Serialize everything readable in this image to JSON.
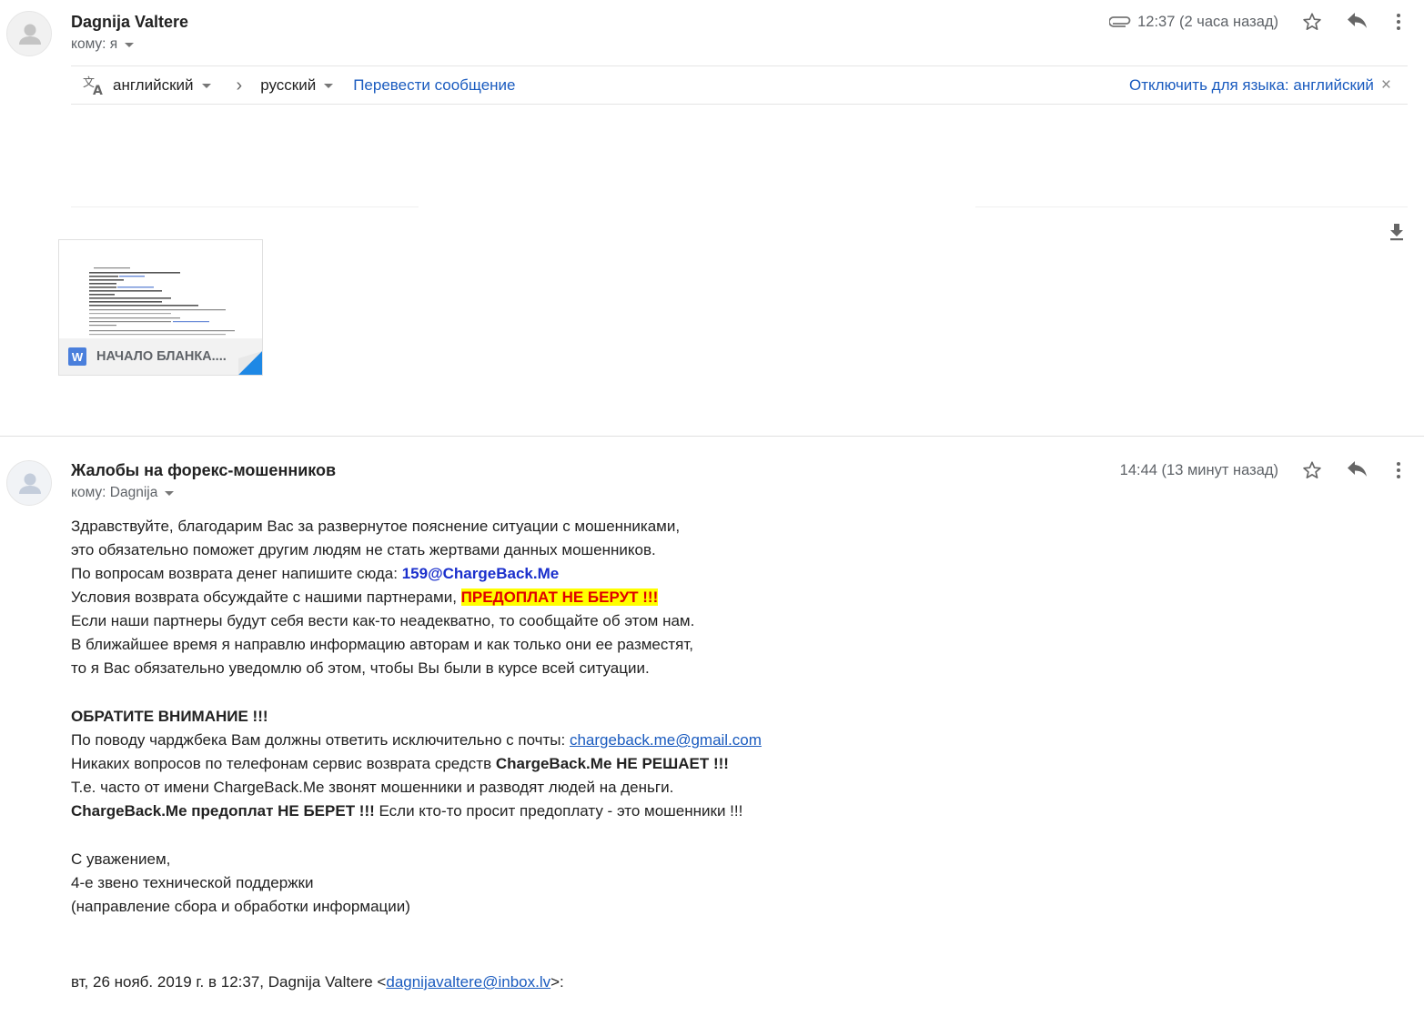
{
  "message1": {
    "sender": "Dagnija Valtere",
    "to_label": "кому: я",
    "time": "12:37 (2 часа назад)",
    "icons": [
      "paperclip-icon",
      "star-icon",
      "reply-icon",
      "more-vert-icon",
      "download-icon"
    ],
    "translate": {
      "source_lang": "английский",
      "separator": "›",
      "target_lang": "русский",
      "translate_link": "Перевести сообщение",
      "disable_link": "Отключить для языка: английский",
      "close": "×"
    },
    "attachment": {
      "name": "НАЧАЛО БЛАНКА....",
      "type_badge": "W"
    }
  },
  "message2": {
    "subject": "Жалобы на форекс-мошенников",
    "to_label": "кому: Dagnija",
    "time": "14:44 (13 минут назад)",
    "body": {
      "l1": "Здравствуйте, благодарим Вас за развернутое пояснение ситуации с мошенниками,",
      "l2": "это обязательно поможет другим людям не стать жертвами данных мошенников.",
      "l3_text": "По вопросам возврата денег напишите сюда: ",
      "l3_email": "159@ChargeBack.Me",
      "l4_text": "Условия возврата обсуждайте с нашими партнерами, ",
      "l4_warn": "ПРЕДОПЛАТ НЕ БЕРУТ !!!",
      "l5": "Если наши партнеры будут себя вести как-то неадекватно, то сообщайте об этом нам.",
      "l6": "В ближайшее время я направлю информацию авторам и как только они ее разместят,",
      "l7": "то я Вас обязательно уведомлю об этом, чтобы Вы были в курсе всей ситуации.",
      "attention": "ОБРАТИТЕ ВНИМАНИЕ !!!",
      "l8_text": "По поводу чарджбека Вам должны ответить исключительно с почты: ",
      "l8_email": "chargeback.me@gmail.com",
      "l9_text": "Никаких вопросов по телефонам сервис возврата средств ",
      "l9_bold": "ChargeBack.Me НЕ РЕШАЕТ !!!",
      "l10": "Т.е. часто от имени ChargeBack.Me звонят мошенники и разводят людей на деньги.",
      "l11_bold": "ChargeBack.Me предоплат НЕ БЕРЕТ !!!",
      "l11_text": " Если кто-то просит предоплату - это мошенники !!!",
      "sign1": "С уважением,",
      "sign2": "4-е звено технической поддержки",
      "sign3": "(направление сбора и обработки информации)",
      "quote_prefix": "вт, 26 нояб. 2019 г. в 12:37, Dagnija Valtere <",
      "quote_email": "dagnijavaltere@inbox.lv",
      "quote_suffix": ">:"
    }
  }
}
